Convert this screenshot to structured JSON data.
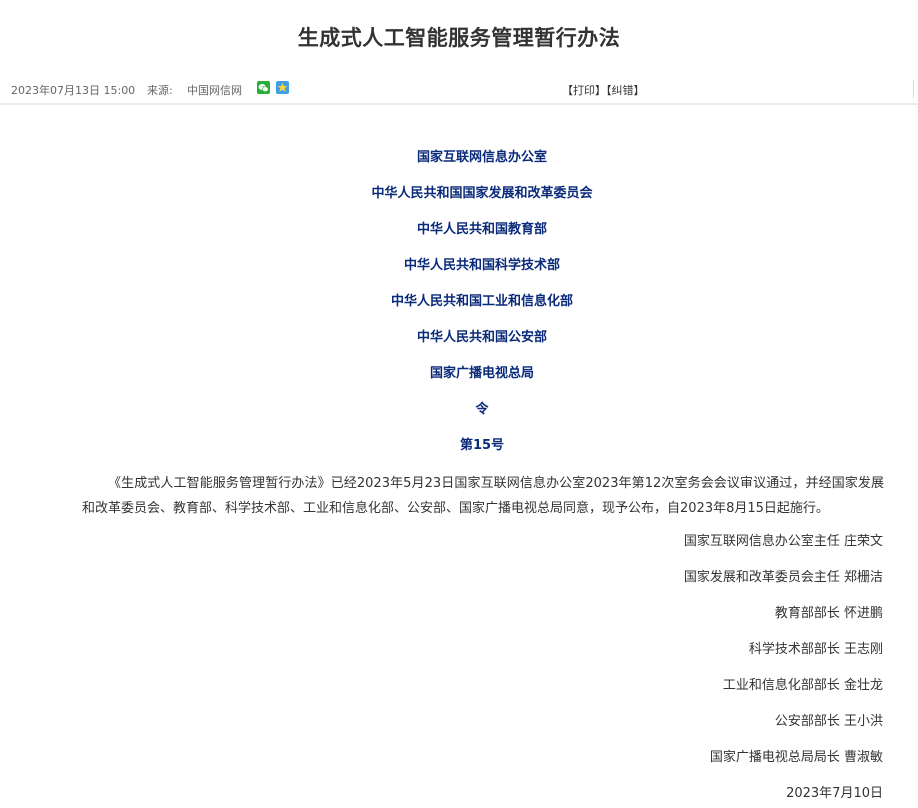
{
  "page": {
    "title": "生成式人工智能服务管理暂行办法"
  },
  "meta": {
    "date": "2023年07月13日 15:00",
    "source_label": "来源:",
    "source": "中国网信网",
    "print_label": "【打印】",
    "error_label": "【纠错】"
  },
  "icons": {
    "wechat": "wechat-icon",
    "qzone": "qzone-star-icon"
  },
  "colors": {
    "issuer_text": "#0a2a7a",
    "body_text": "#333333",
    "wechat": "#2aae3a",
    "qzone": "#3ca0e8"
  },
  "document": {
    "issuers": [
      "国家互联网信息办公室",
      "中华人民共和国国家发展和改革委员会",
      "中华人民共和国教育部",
      "中华人民共和国科学技术部",
      "中华人民共和国工业和信息化部",
      "中华人民共和国公安部",
      "国家广播电视总局"
    ],
    "order_label": "令",
    "order_number": "第15号",
    "body": "《生成式人工智能服务管理暂行办法》已经2023年5月23日国家互联网信息办公室2023年第12次室务会会议审议通过，并经国家发展和改革委员会、教育部、科学技术部、工业和信息化部、公安部、国家广播电视总局同意，现予公布，自2023年8月15日起施行。",
    "signatures": [
      "国家互联网信息办公室主任 庄荣文",
      "国家发展和改革委员会主任 郑栅洁",
      "教育部部长 怀进鹏",
      "科学技术部部长 王志刚",
      "工业和信息化部部长 金壮龙",
      "公安部部长 王小洪",
      "国家广播电视总局局长 曹淑敏"
    ],
    "sign_date": "2023年7月10日"
  }
}
